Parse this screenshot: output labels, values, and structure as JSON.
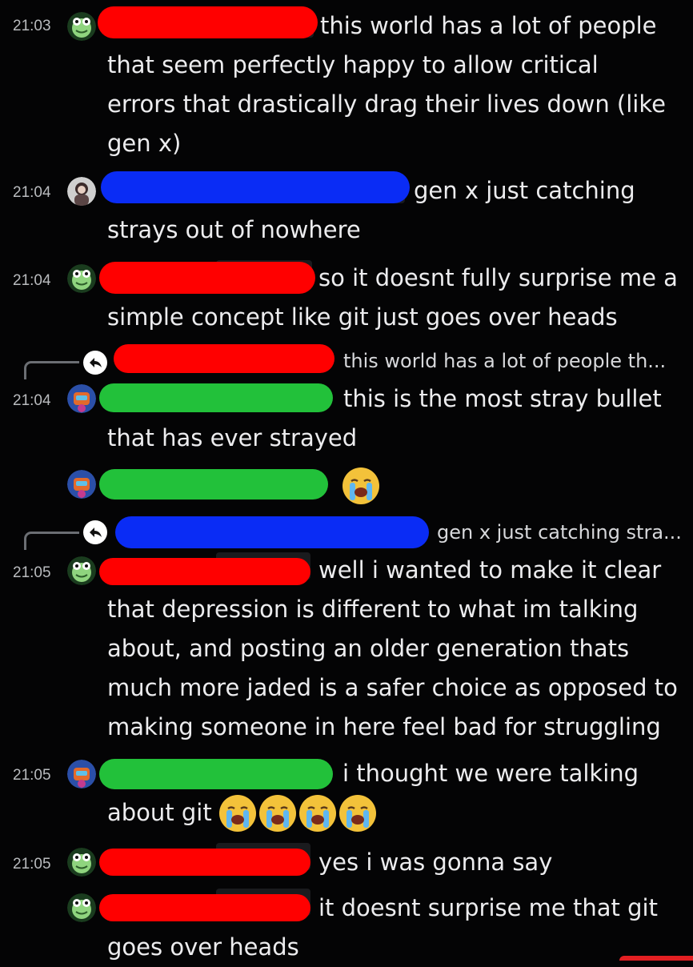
{
  "messages": [
    {
      "time": "21:03",
      "lines": [
        "this world has a lot of people",
        "that seem perfectly happy to allow critical",
        "errors that drastically drag their lives down (like",
        "gen x)"
      ]
    },
    {
      "time": "21:04",
      "lines": [
        "gen x just catching",
        "strays out of nowhere"
      ]
    },
    {
      "time": "21:04",
      "lines": [
        "so it doesnt fully surprise me a",
        "simple concept like git just goes over heads"
      ]
    },
    {
      "time": "21:04",
      "reply_preview": "this world has a lot of people th...",
      "lines": [
        "this is the most stray bullet",
        "that has ever strayed"
      ]
    },
    {
      "time": "",
      "lines": []
    },
    {
      "time": "21:05",
      "reply_preview": "gen x just catching stra...",
      "lines": [
        "well i wanted to make it clear",
        "that depression is different to what im talking",
        "about, and posting an older generation thats",
        "much more jaded is a safer choice as opposed to",
        "making someone in here feel bad for struggling"
      ]
    },
    {
      "time": "21:05",
      "lines": [
        "i thought we were talking",
        "about git"
      ]
    },
    {
      "time": "21:05",
      "lines": [
        "yes i was gonna say"
      ]
    },
    {
      "time": "",
      "lines": [
        "it doesnt surprise me that git",
        "goes over heads"
      ]
    }
  ],
  "colors": {
    "background": "#040405",
    "redaction_red": "#ff0000",
    "redaction_blue": "#0a2cf5",
    "redaction_green": "#22c13a"
  },
  "icons": {
    "reply": "reply-arrow-icon",
    "emoji": "loudly-crying-face-emoji"
  }
}
